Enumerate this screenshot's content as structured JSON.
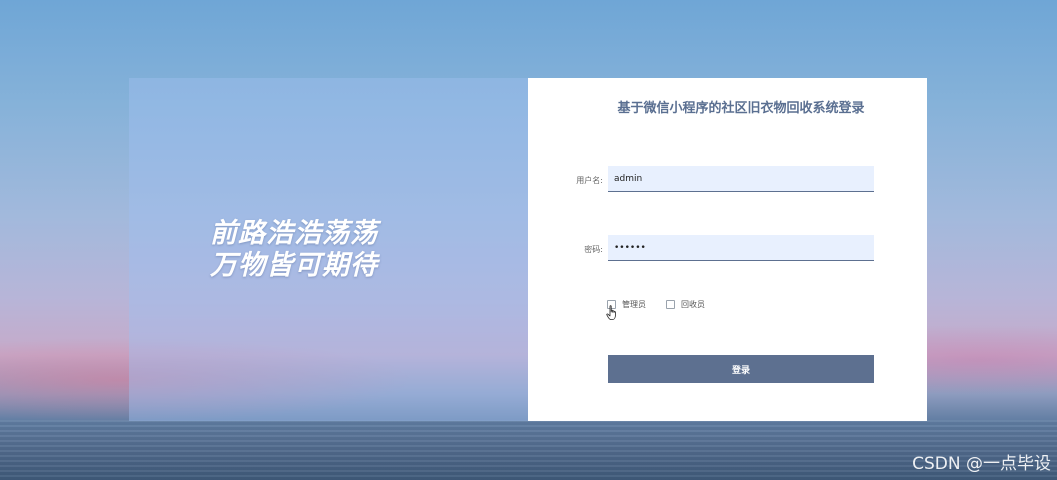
{
  "slogan": {
    "line1": "前路浩浩荡荡",
    "line2": "万物皆可期待"
  },
  "login": {
    "title": "基于微信小程序的社区旧衣物回收系统登录",
    "username_label": "用户名:",
    "username_value": "admin",
    "password_label": "密码:",
    "password_value": "123456",
    "roles": [
      "管理员",
      "回收员"
    ],
    "submit_label": "登录"
  },
  "watermark": "CSDN @一点毕设",
  "colors": {
    "accent": "#5d7090",
    "input_bg": "#e8f0fe",
    "title": "#5a6f91"
  }
}
